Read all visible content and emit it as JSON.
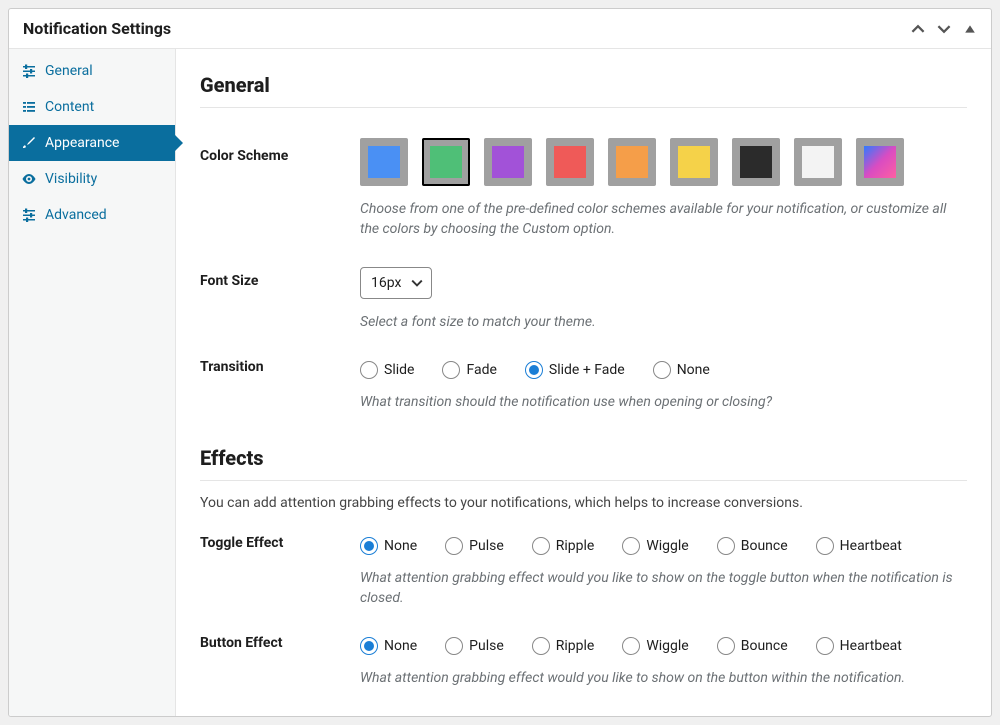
{
  "header": {
    "title": "Notification Settings"
  },
  "sidebar": {
    "items": [
      {
        "id": "general",
        "label": "General",
        "icon": "sliders"
      },
      {
        "id": "content",
        "label": "Content",
        "icon": "list"
      },
      {
        "id": "appearance",
        "label": "Appearance",
        "icon": "brush",
        "active": true
      },
      {
        "id": "visibility",
        "label": "Visibility",
        "icon": "eye"
      },
      {
        "id": "advanced",
        "label": "Advanced",
        "icon": "sliders"
      }
    ]
  },
  "sections": {
    "general": {
      "title": "General",
      "color_scheme": {
        "label": "Color Scheme",
        "desc": "Choose from one of the pre-defined color schemes available for your notification, or customize all the colors by choosing the Custom option.",
        "selected": 1,
        "colors": [
          "#4a90f4",
          "#4fbf77",
          "#a252d8",
          "#ef5a58",
          "#f59e49",
          "#f5d249",
          "#2b2b2b",
          "#f3f3f3",
          "gradient"
        ]
      },
      "font_size": {
        "label": "Font Size",
        "value": "16px",
        "desc": "Select a font size to match your theme."
      },
      "transition": {
        "label": "Transition",
        "desc": "What transition should the notification use when opening or closing?",
        "options": [
          "Slide",
          "Fade",
          "Slide + Fade",
          "None"
        ],
        "selected": 2
      }
    },
    "effects": {
      "title": "Effects",
      "intro": "You can add attention grabbing effects to your notifications, which helps to increase conversions.",
      "toggle": {
        "label": "Toggle Effect",
        "desc": "What attention grabbing effect would you like to show on the toggle button when the notification is closed.",
        "options": [
          "None",
          "Pulse",
          "Ripple",
          "Wiggle",
          "Bounce",
          "Heartbeat"
        ],
        "selected": 0
      },
      "button": {
        "label": "Button Effect",
        "desc": "What attention grabbing effect would you like to show on the button within the notification.",
        "options": [
          "None",
          "Pulse",
          "Ripple",
          "Wiggle",
          "Bounce",
          "Heartbeat"
        ],
        "selected": 0
      }
    }
  }
}
